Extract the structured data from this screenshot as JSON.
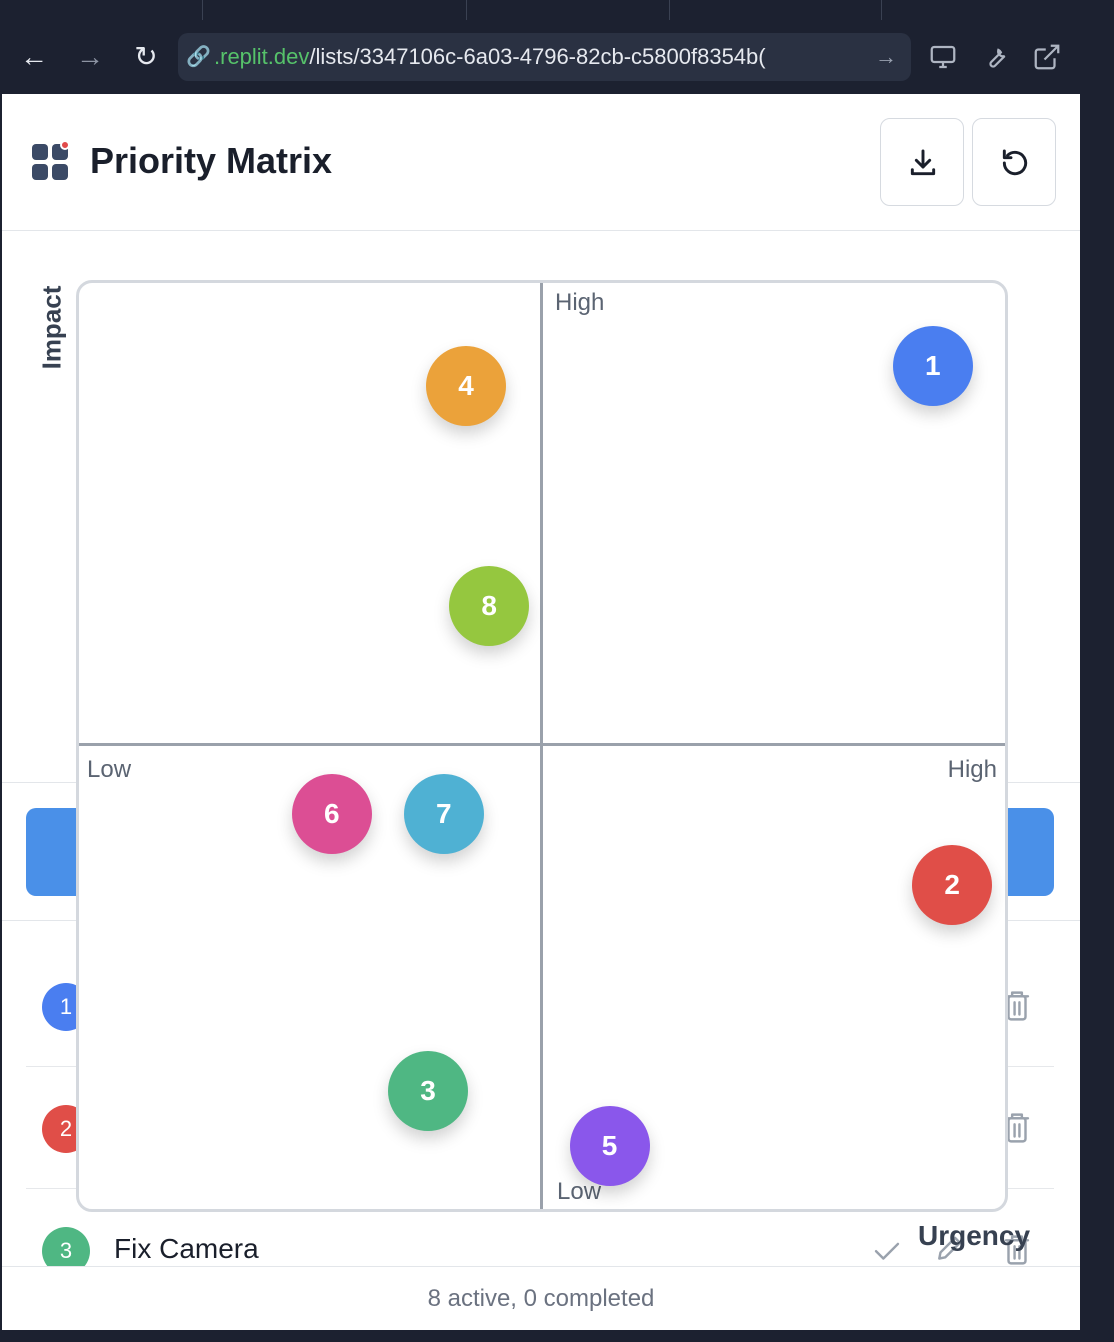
{
  "browser": {
    "url_host": ".replit.dev",
    "url_path": "/lists/3347106c-6a03-4796-82cb-c5800f8354b("
  },
  "app": {
    "title": "Priority Matrix",
    "buttons": {
      "download": "download-icon",
      "reset": "reset-icon"
    }
  },
  "matrix": {
    "y_axis_label": "Impact",
    "x_axis_label": "Urgency",
    "impact_high": "High",
    "impact_low": "Low",
    "urgency_low": "Low",
    "urgency_high": "High",
    "items": [
      {
        "label": "1",
        "color": "#4a7ef0",
        "urgency": 0.922,
        "impact": 0.91
      },
      {
        "label": "2",
        "color": "#e04e48",
        "urgency": 0.943,
        "impact": 0.35
      },
      {
        "label": "3",
        "color": "#4fb783",
        "urgency": 0.377,
        "impact": 0.127
      },
      {
        "label": "4",
        "color": "#eba23a",
        "urgency": 0.418,
        "impact": 0.889
      },
      {
        "label": "5",
        "color": "#8a57eb",
        "urgency": 0.573,
        "impact": 0.068
      },
      {
        "label": "6",
        "color": "#dc4e94",
        "urgency": 0.273,
        "impact": 0.427
      },
      {
        "label": "7",
        "color": "#4fb1d3",
        "urgency": 0.394,
        "impact": 0.427
      },
      {
        "label": "8",
        "color": "#95c73f",
        "urgency": 0.443,
        "impact": 0.651
      }
    ]
  },
  "tasks": [
    {
      "number": "1",
      "name": "",
      "color": "#4a7ef0"
    },
    {
      "number": "2",
      "name": "",
      "color": "#e04e48"
    },
    {
      "number": "3",
      "name": "Fix Camera",
      "color": "#4fb783"
    }
  ],
  "footer": {
    "status": "8 active, 0 completed"
  }
}
